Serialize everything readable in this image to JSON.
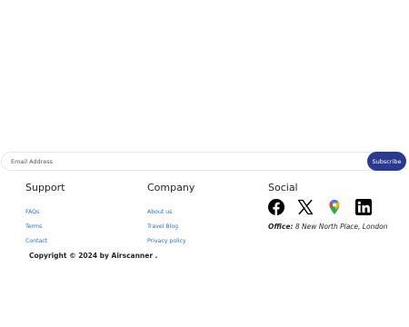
{
  "newsletter": {
    "email_placeholder": "Email Address",
    "subscribe_label": "Subscribe",
    "accent_color": "#2b3a8f"
  },
  "support": {
    "heading": "Support",
    "links": [
      "FAQs",
      "Terms",
      "Contact"
    ]
  },
  "company": {
    "heading": "Company",
    "links": [
      "About us",
      "Travel Blog",
      "Privacy policy"
    ]
  },
  "social": {
    "heading": "Social",
    "icons": [
      "facebook-icon",
      "x-icon",
      "google-maps-icon",
      "linkedin-icon"
    ],
    "office_label": "Office:",
    "office_address": "8 New North Place, London"
  },
  "footer": {
    "copyright": "Copyright © 2024 by Airscanner ."
  }
}
